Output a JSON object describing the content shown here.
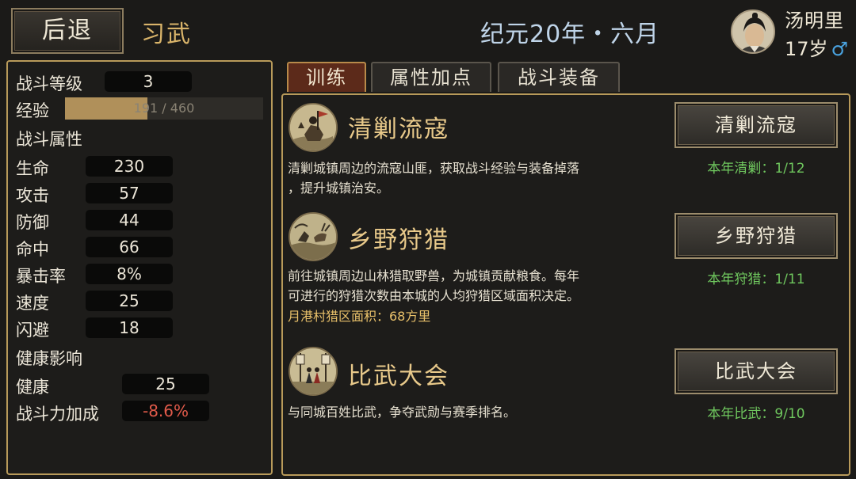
{
  "header": {
    "back_label": "后退",
    "page_title": "习武",
    "date": "纪元20年・六月",
    "character": {
      "name": "汤明里",
      "age": "17岁",
      "gender_symbol": "♂"
    }
  },
  "stats": {
    "combat_level_label": "战斗等级",
    "combat_level": "3",
    "exp_label": "经验",
    "exp_text": "191 / 460",
    "exp_current": 191,
    "exp_max": 460,
    "attributes_heading": "战斗属性",
    "attributes": [
      {
        "label": "生命",
        "value": "230"
      },
      {
        "label": "攻击",
        "value": "57"
      },
      {
        "label": "防御",
        "value": "44"
      },
      {
        "label": "命中",
        "value": "66"
      },
      {
        "label": "暴击率",
        "value": "8%"
      },
      {
        "label": "速度",
        "value": "25"
      },
      {
        "label": "闪避",
        "value": "18"
      }
    ],
    "health_heading": "健康影响",
    "health_label": "健康",
    "health_value": "25",
    "bonus_label": "战斗力加成",
    "bonus_value": "-8.6%",
    "bonus_color": "#e05a4a"
  },
  "tabs": [
    {
      "label": "训练",
      "active": true
    },
    {
      "label": "属性加点",
      "active": false
    },
    {
      "label": "战斗装备",
      "active": false
    }
  ],
  "activities": [
    {
      "title": "清剿流寇",
      "icon": "bandit-raid-icon",
      "desc": [
        "清剿城镇周边的流寇山匪，获取战斗经验与装备掉落",
        "，提升城镇治安。"
      ],
      "extra": "",
      "button": "清剿流寇",
      "count": "本年清剿：1/12"
    },
    {
      "title": "乡野狩猎",
      "icon": "hunting-icon",
      "desc": [
        "前往城镇周边山林猎取野兽，为城镇贡献粮食。每年",
        "可进行的狩猎次数由本城的人均狩猎区域面积决定。"
      ],
      "extra": "月港村猎区面积：68方里",
      "button": "乡野狩猎",
      "count": "本年狩猎：1/11"
    },
    {
      "title": "比武大会",
      "icon": "tournament-icon",
      "desc": [
        "与同城百姓比武，争夺武勋与赛季排名。"
      ],
      "extra": "",
      "button": "比武大会",
      "count": "本年比武：9/10"
    }
  ]
}
